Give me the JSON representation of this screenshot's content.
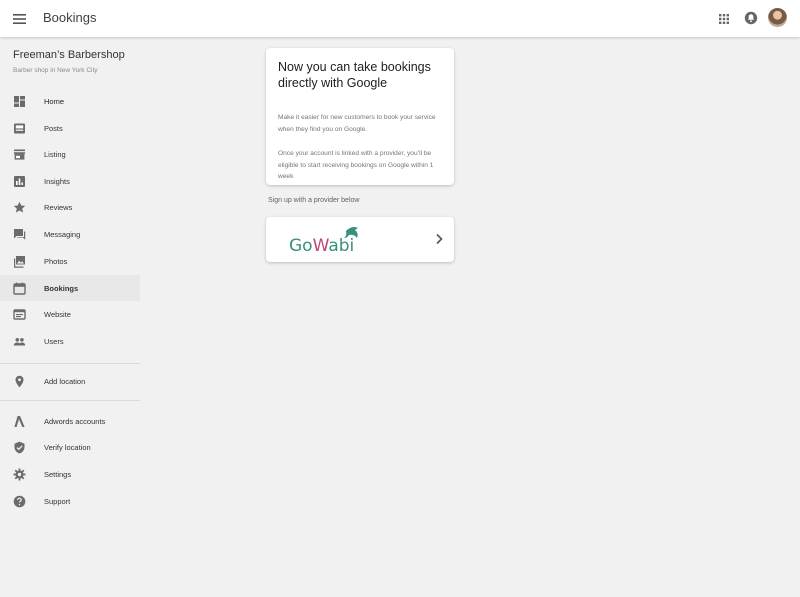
{
  "header": {
    "title": "Bookings",
    "menu_icon": "hamburger-menu-icon",
    "apps_icon": "apps-grid-icon",
    "notifications_icon": "notifications-icon",
    "avatar": "user-avatar"
  },
  "business": {
    "name": "Freeman’s Barbershop",
    "subtitle": "Barber shop in New York City"
  },
  "sidebar": {
    "items": [
      {
        "label": "Home",
        "icon": "dashboard-icon"
      },
      {
        "label": "Posts",
        "icon": "posts-icon"
      },
      {
        "label": "Listing",
        "icon": "storefront-icon"
      },
      {
        "label": "Insights",
        "icon": "bar-chart-icon"
      },
      {
        "label": "Reviews",
        "icon": "star-icon"
      },
      {
        "label": "Messaging",
        "icon": "chat-icon"
      },
      {
        "label": "Photos",
        "icon": "photos-icon"
      },
      {
        "label": "Bookings",
        "icon": "calendar-icon",
        "active": true
      },
      {
        "label": "Website",
        "icon": "website-icon"
      },
      {
        "label": "Users",
        "icon": "people-icon"
      }
    ],
    "secondary": [
      {
        "label": "Add location",
        "icon": "location-pin-icon"
      }
    ],
    "tertiary": [
      {
        "label": "Adwords accounts",
        "icon": "adwords-icon"
      },
      {
        "label": "Verify location",
        "icon": "shield-check-icon"
      },
      {
        "label": "Settings",
        "icon": "gear-icon"
      },
      {
        "label": "Support",
        "icon": "help-icon"
      }
    ]
  },
  "promo": {
    "title": "Now you can take bookings directly with Google",
    "paragraph1": "Make it easier for new customers to book your service when they find you on Google.",
    "paragraph2": "Once your account is linked with a provider, you’ll be eligible to start receiving bookings on Google within 1 week"
  },
  "signup": {
    "text": "Sign up with a provider below"
  },
  "provider": {
    "name": "GoWabi",
    "icon": "chevron-right-icon",
    "brand_color": "#3a8f7e"
  },
  "colors": {
    "background": "#f1f1f1",
    "surface": "#ffffff",
    "active_item": "#e8e8e8",
    "icon_gray": "#6b6b6b"
  }
}
